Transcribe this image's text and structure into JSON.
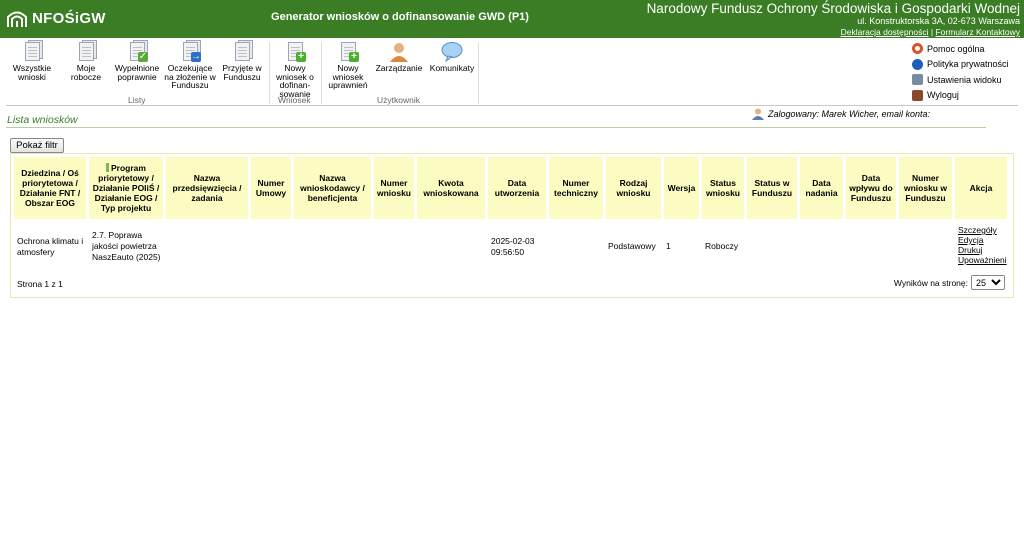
{
  "header": {
    "logo_text": "NFOŚiGW",
    "app_title": "Generator wniosków o dofinansowanie GWD (P1)",
    "org_name": "Narodowy Fundusz Ochrony Środowiska i Gospodarki Wodnej",
    "org_address": "ul. Konstruktorska 3A, 02-673 Warszawa",
    "link_accessibility": "Deklaracja dostępności",
    "link_separator": "|",
    "link_contact": "Formularz Kontaktowy"
  },
  "ribbon": {
    "all_applications": "Wszystkie wnioski",
    "my_drafts": "Moje robocze",
    "filled_correctly": "Wypełnione poprawnie",
    "awaiting_submission": "Oczekujące na złożenie w Funduszu",
    "accepted": "Przyjęte w Funduszu",
    "new_application": "Nowy wniosek o dofinan-sowanie",
    "new_authorization": "Nowy wniosek uprawnień",
    "management": "Zarządzanie",
    "messages": "Komunikaty",
    "group_lists": "Listy",
    "group_application": "Wniosek",
    "group_user": "Użytkownik"
  },
  "side_links": [
    {
      "label": "Pomoc ogólna",
      "icon": "help-ring-icon",
      "color": "#d9532c"
    },
    {
      "label": "Polityka prywatności",
      "icon": "info-icon",
      "color": "#1f5fb8"
    },
    {
      "label": "Ustawienia widoku",
      "icon": "settings-view-icon",
      "color": "#7a8aa0"
    },
    {
      "label": "Wyloguj",
      "icon": "logout-icon",
      "color": "#8a4a2a"
    }
  ],
  "list_title": "Lista wniosków",
  "user_info": "Zalogowany: Marek Wicher, email konta:",
  "filter_button": "Pokaż filtr",
  "table": {
    "columns": [
      "Dziedzina / Oś priorytetowa / Działanie FNT / Obszar EOG",
      "Program priorytetowy / Działanie POIiŚ / Działanie EOG / Typ projektu",
      "Nazwa przedsięwzięcia / zadania",
      "Numer Umowy",
      "Nazwa wnioskodawcy / beneficjenta",
      "Numer wniosku",
      "Kwota wnioskowana",
      "Data utworzenia",
      "Numer techniczny",
      "Rodzaj wniosku",
      "Wersja",
      "Status wniosku",
      "Status w Funduszu",
      "Data nadania",
      "Data wpływu do Funduszu",
      "Numer wniosku w Funduszu",
      "Akcja"
    ],
    "rows": [
      {
        "domain": "Ochrona klimatu i atmosfery",
        "program": "2.7. Poprawa jakości powietrza NaszEauto (2025)",
        "project_name": "",
        "contract_no": "",
        "applicant": "",
        "application_no": "",
        "amount": "",
        "created": "2025-02-03 09:56:50",
        "tech_no": "",
        "type": "Podstawowy",
        "version": "1",
        "status": "Roboczy",
        "fund_status": "",
        "assigned_date": "",
        "received_date": "",
        "fund_no": "",
        "actions": [
          "Szczegóły",
          "Edycja",
          "Drukuj",
          "Upoważnieni"
        ]
      }
    ]
  },
  "pager": {
    "page_text": "Strona 1 z 1",
    "per_page_label": "Wyników na stronę:",
    "per_page_value": "25"
  }
}
